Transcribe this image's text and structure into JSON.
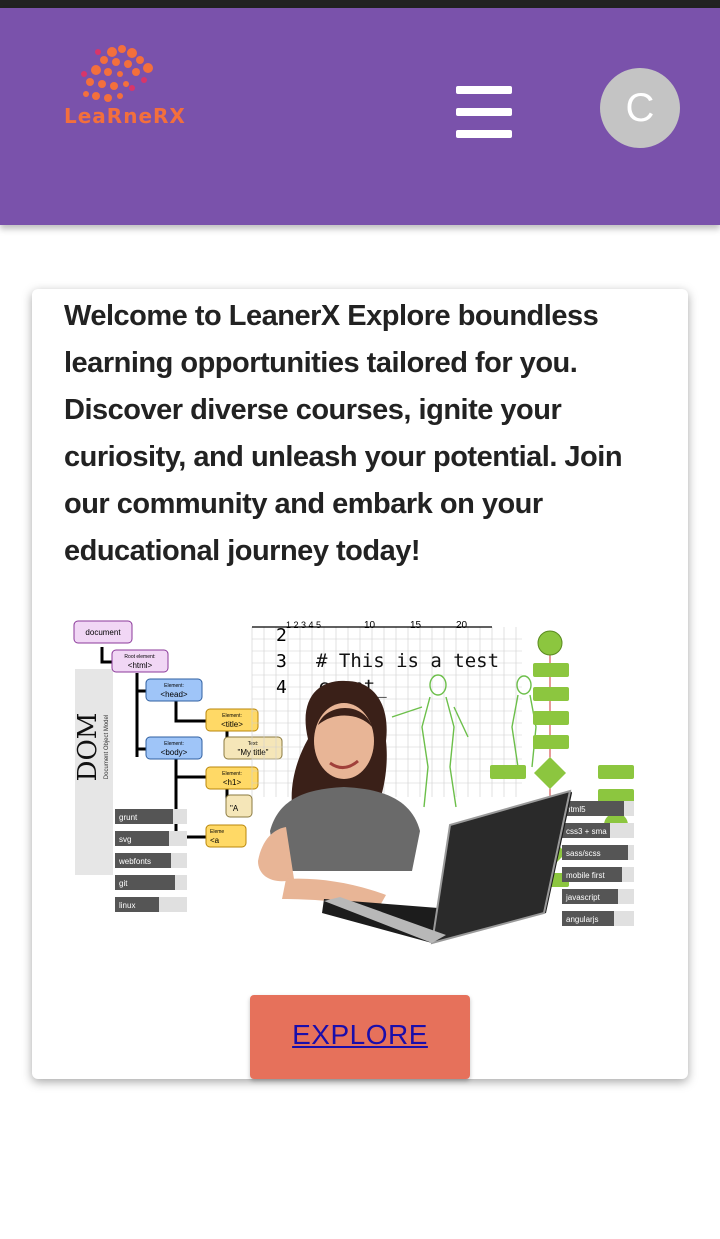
{
  "brand": {
    "logo_text": "LeaRneRX",
    "logo_color": "#f36f3c"
  },
  "header": {
    "background": "#7a52ab",
    "menu_icon": "hamburger-menu-icon",
    "avatar_initial": "C"
  },
  "hero": {
    "welcome_text": "Welcome to LeanerX Explore boundless learning opportunities tailored for you. Discover diverse courses, ignite your curiosity, and unleash your potential. Join our community and embark on your educational journey today!",
    "explore_label": "EXPLORE",
    "explore_color": "#e6715b"
  },
  "illustration": {
    "dom_title": "DOM",
    "dom_subtitle": "Document Object Model",
    "dom_nodes": [
      "document",
      "Root element:",
      "<html>",
      "Element:",
      "<head>",
      "Element:",
      "<title>",
      "Text:",
      "\"My title\"",
      "Element:",
      "<body>",
      "Element:",
      "<h1>",
      "\"A",
      "Eleme",
      "<a"
    ],
    "code_lines": [
      "# This is a test",
      "count_"
    ],
    "line_numbers": [
      "2",
      "3",
      "4"
    ],
    "axis_ticks": [
      "1 2 3 4 5",
      "10",
      "15",
      "20"
    ],
    "tools": [
      "grunt",
      "svg",
      "webfonts",
      "git",
      "linux"
    ],
    "skills": [
      "html5",
      "css3 + sma",
      "sass/scss",
      "mobile first",
      "javascript",
      "angularjs"
    ]
  }
}
